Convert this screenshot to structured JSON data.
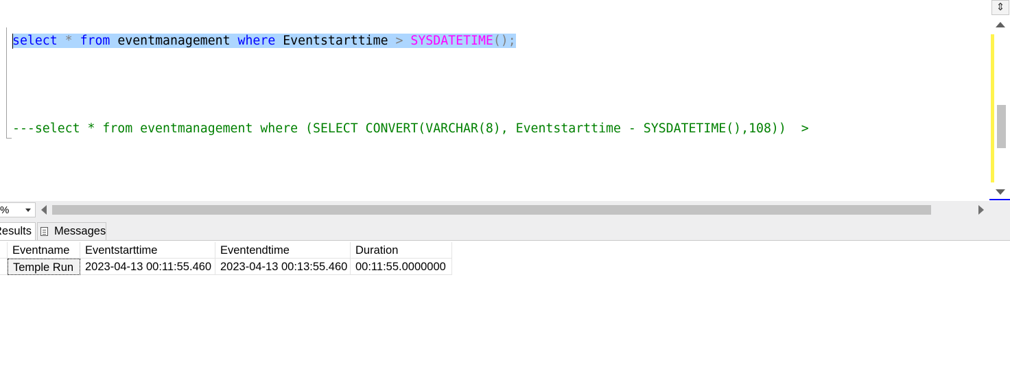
{
  "editor": {
    "line1": {
      "kw_select": "select",
      "star": "*",
      "kw_from": "from",
      "table": "eventmanagement",
      "kw_where": "where",
      "column": "Eventstarttime",
      "op": ">",
      "func": "SYSDATETIME",
      "tail": "();"
    },
    "line2": "---select * from eventmanagement where (SELECT CONVERT(VARCHAR(8), Eventstarttime - SYSDATETIME(),108))  >"
  },
  "status": {
    "zoom": "%"
  },
  "tabs": {
    "results": "Results",
    "messages": "Messages"
  },
  "grid": {
    "columns": [
      "Eventname",
      "Eventstarttime",
      "Eventendtime",
      "Duration"
    ],
    "rows": [
      [
        "Temple Run",
        "2023-04-13 00:11:55.460",
        "2023-04-13 00:13:55.460",
        "00:11:55.0000000"
      ]
    ]
  },
  "icons": {
    "split": "split-view-icon",
    "messages": "messages-icon"
  }
}
